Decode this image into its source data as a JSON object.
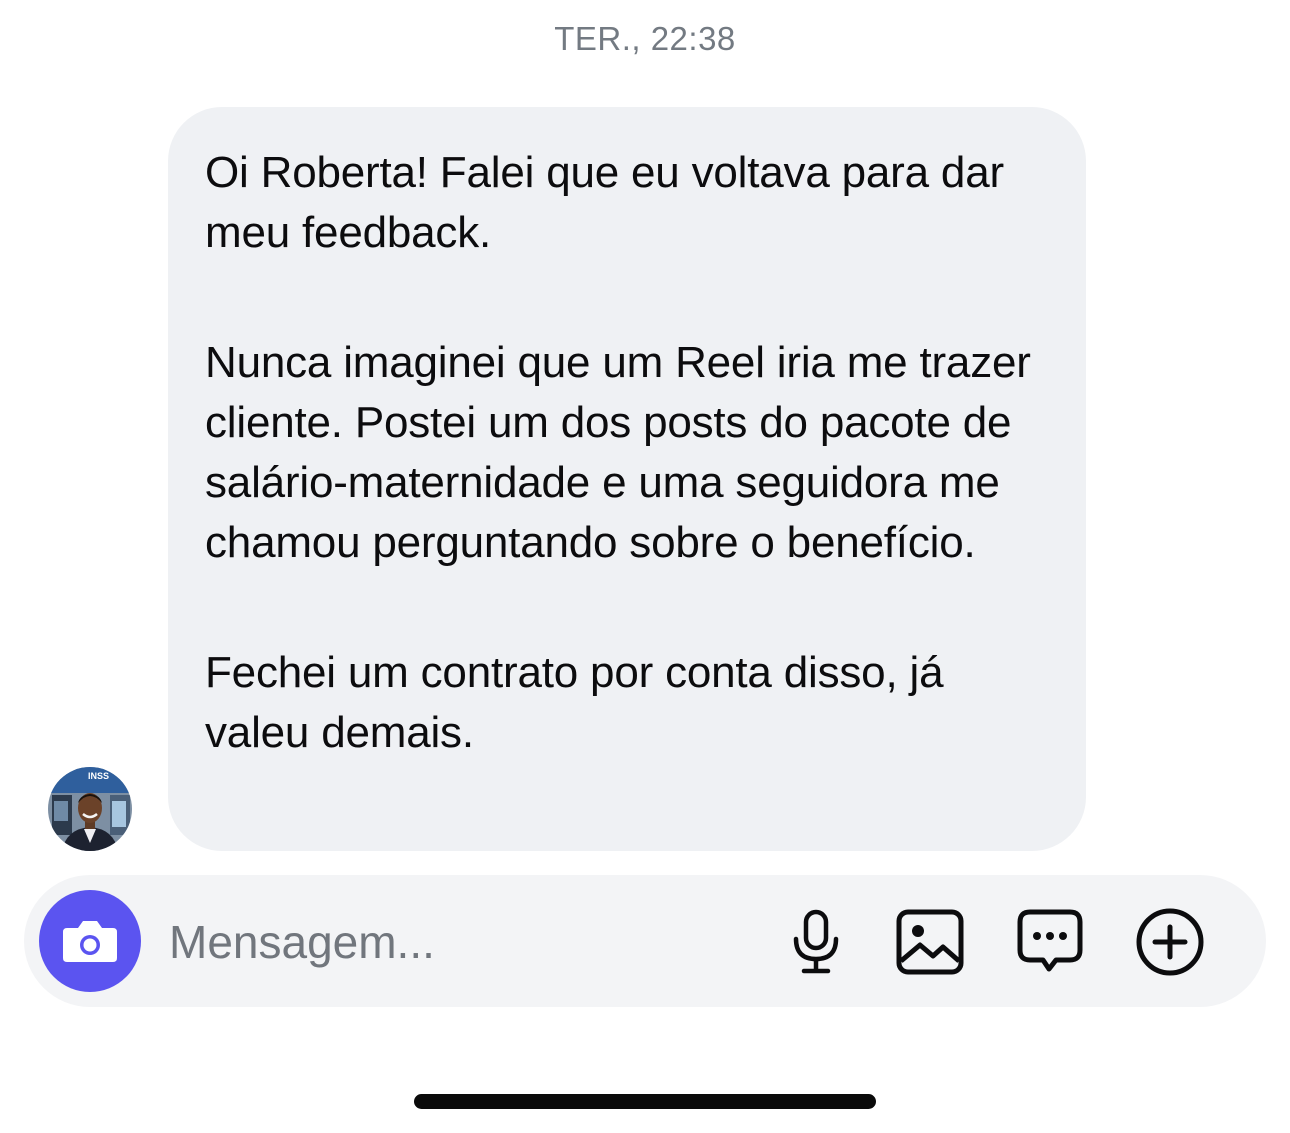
{
  "chat": {
    "timestamp": "TER., 22:38",
    "message": {
      "paragraphs": [
        "Oi Roberta! Falei que eu voltava para dar meu feedback.",
        "Nunca imaginei que um Reel iria me trazer cliente. Postei um dos posts do pacote de salário-maternidade e uma seguidora me chamou perguntando sobre o benefício.",
        "Fechei um contrato por conta disso, já valeu demais."
      ]
    },
    "avatar_badge": "INSS"
  },
  "composer": {
    "placeholder": "Mensagem...",
    "camera_icon": "camera-icon",
    "tools": [
      "microphone-icon",
      "gallery-icon",
      "sticker-icon",
      "plus-circle-icon"
    ]
  },
  "colors": {
    "camera_button": "#5b54f0",
    "bubble": "#eff1f4",
    "composer": "#f3f4f6",
    "timestamp": "#737a82"
  }
}
